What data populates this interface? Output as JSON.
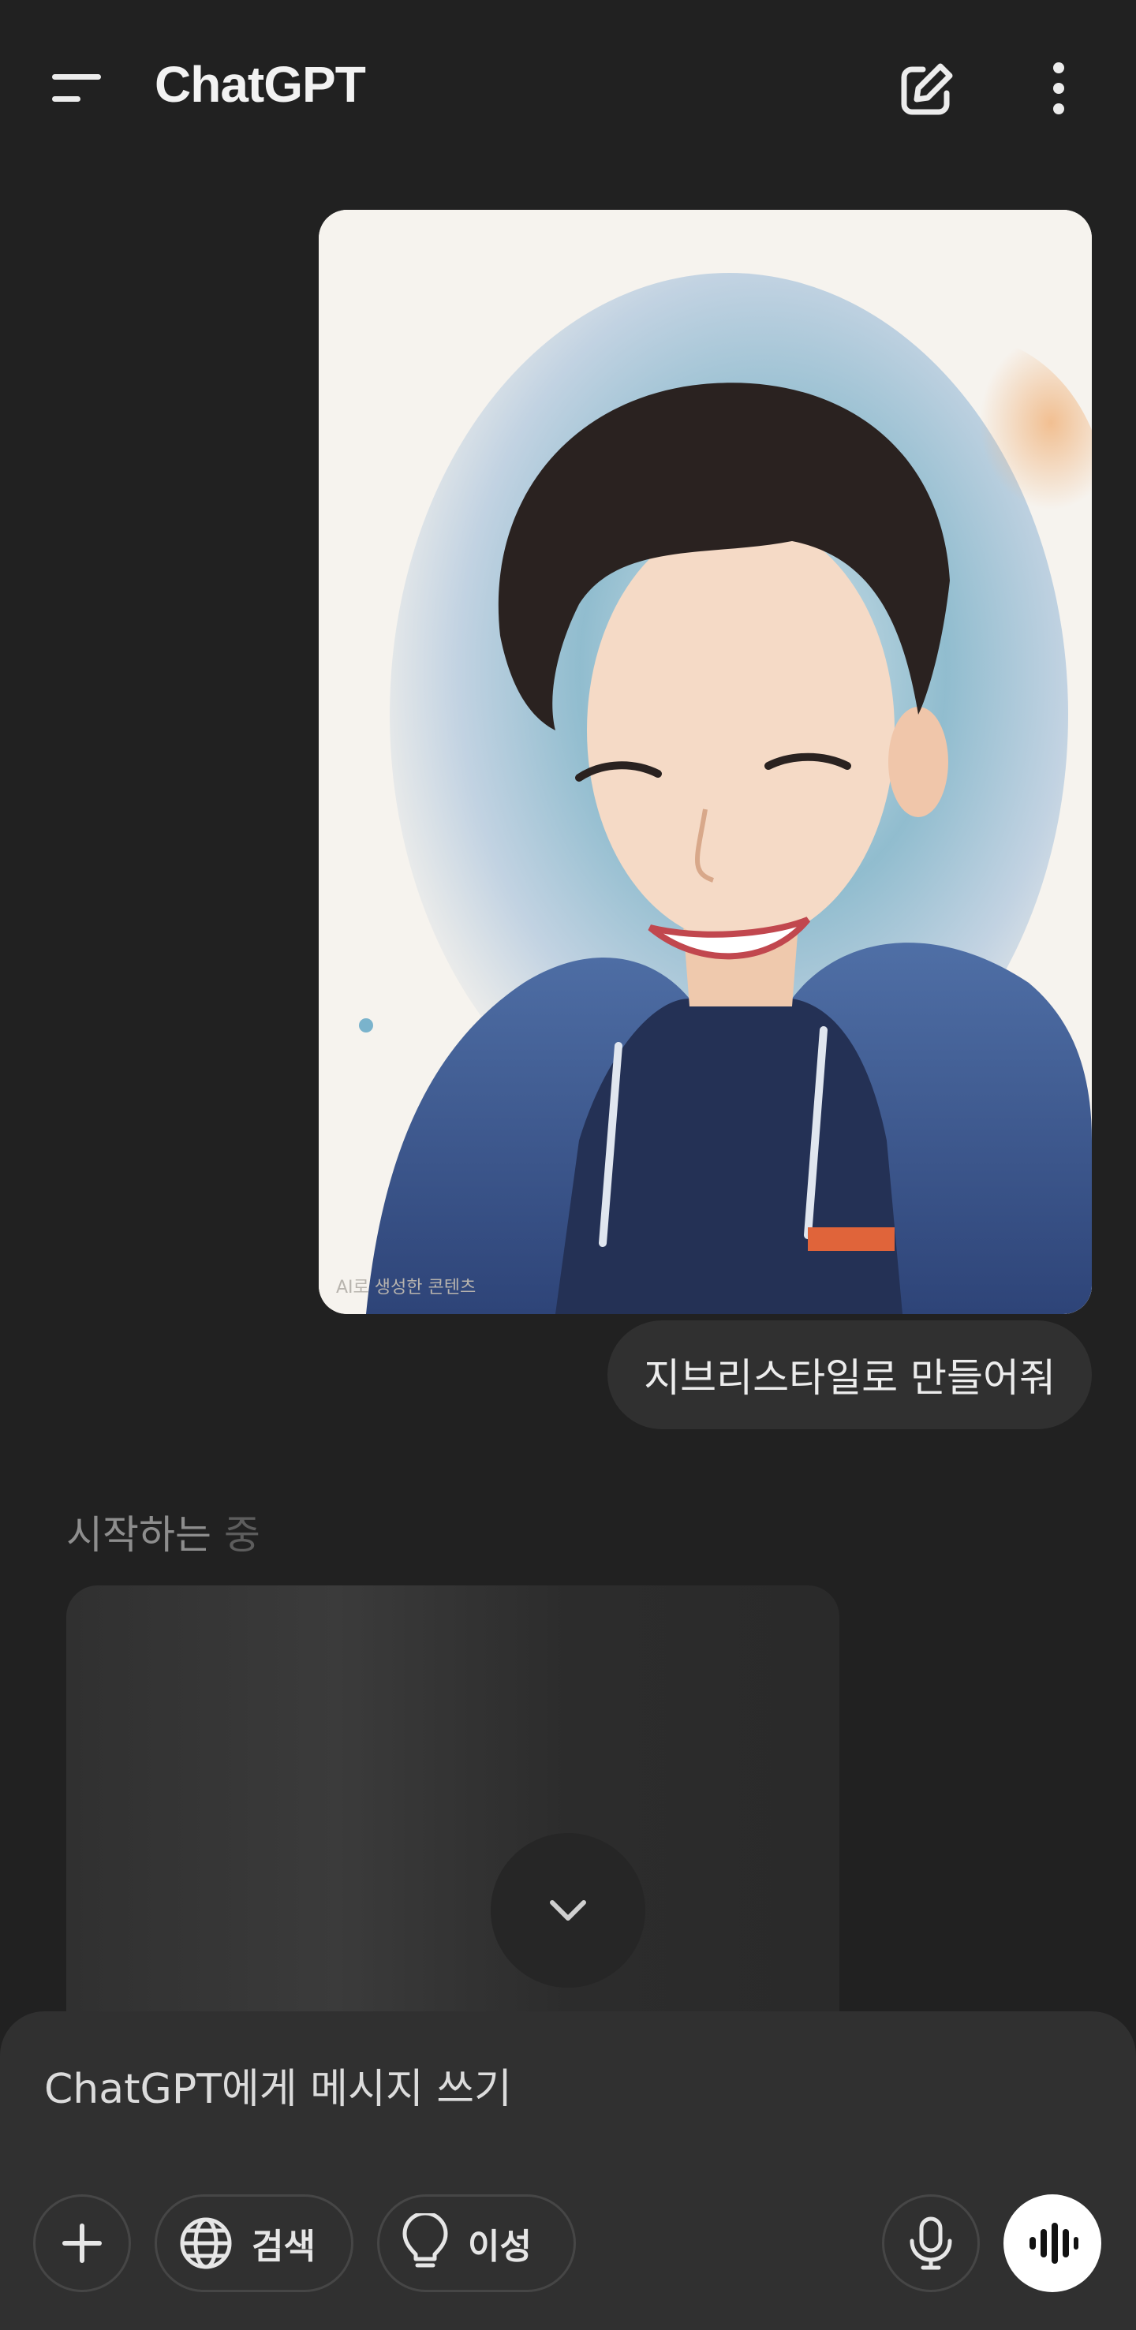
{
  "header": {
    "title": "ChatGPT",
    "menu_icon": "menu-icon",
    "new_chat_icon": "edit-icon",
    "more_icon": "more-vertical-icon"
  },
  "conversation": {
    "user_image": {
      "watermark": "AI로 생성한 콘텐츠"
    },
    "user_message": "지브리스타일로 만들어줘",
    "assistant_status": {
      "part1": "시작하는",
      "part2": "중"
    }
  },
  "composer": {
    "placeholder": "ChatGPT에게 메시지 쓰기",
    "search_label": "검색",
    "reason_label": "이성",
    "plus_icon": "plus-icon",
    "search_icon": "globe-icon",
    "reason_icon": "lightbulb-icon",
    "mic_icon": "mic-icon",
    "voice_icon": "voice-waveform-icon"
  },
  "colors": {
    "background": "#212121",
    "surface": "#303030",
    "text": "#ececec",
    "muted": "#8e8e8e",
    "accent_button": "#ffffff"
  }
}
